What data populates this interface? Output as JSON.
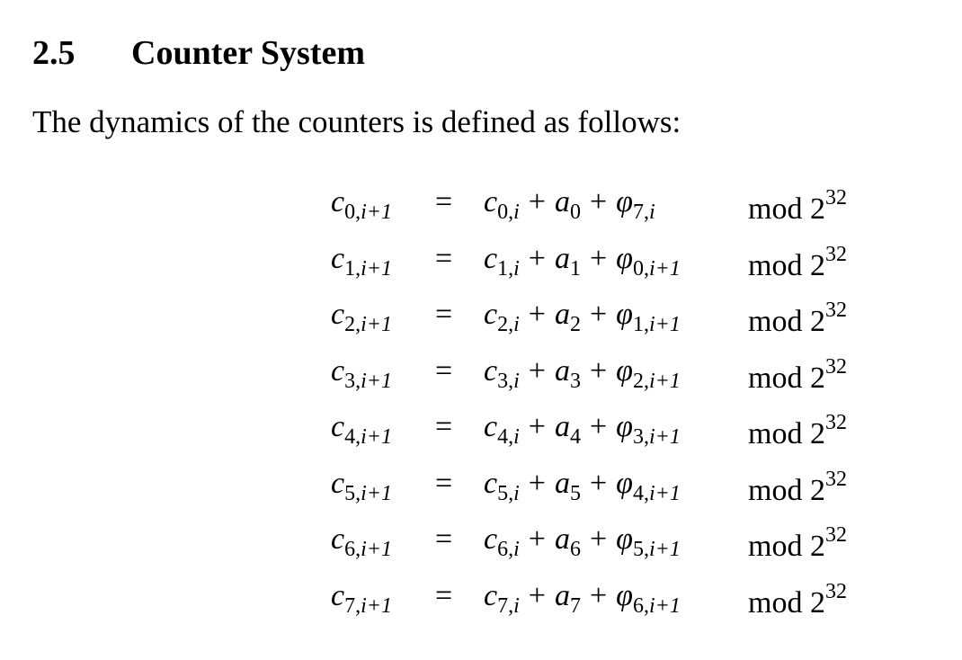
{
  "section": {
    "number": "2.5",
    "title": "Counter System",
    "intro": "The dynamics of the counters is defined as follows:"
  },
  "equations": [
    {
      "c_idx": "0",
      "a_idx": "0",
      "phi_idx": "7",
      "phi_step": "i"
    },
    {
      "c_idx": "1",
      "a_idx": "1",
      "phi_idx": "0",
      "phi_step": "i+1"
    },
    {
      "c_idx": "2",
      "a_idx": "2",
      "phi_idx": "1",
      "phi_step": "i+1"
    },
    {
      "c_idx": "3",
      "a_idx": "3",
      "phi_idx": "2",
      "phi_step": "i+1"
    },
    {
      "c_idx": "4",
      "a_idx": "4",
      "phi_idx": "3",
      "phi_step": "i+1"
    },
    {
      "c_idx": "5",
      "a_idx": "5",
      "phi_idx": "4",
      "phi_step": "i+1"
    },
    {
      "c_idx": "6",
      "a_idx": "6",
      "phi_idx": "5",
      "phi_step": "i+1"
    },
    {
      "c_idx": "7",
      "a_idx": "7",
      "phi_idx": "6",
      "phi_step": "i+1"
    }
  ],
  "symbols": {
    "counter": "c",
    "constant": "a",
    "phi": "φ",
    "step_next": "i+1",
    "step": "i",
    "equals": "=",
    "plus": "+",
    "mod_word": "mod",
    "mod_base": "2",
    "mod_exp": "32"
  }
}
